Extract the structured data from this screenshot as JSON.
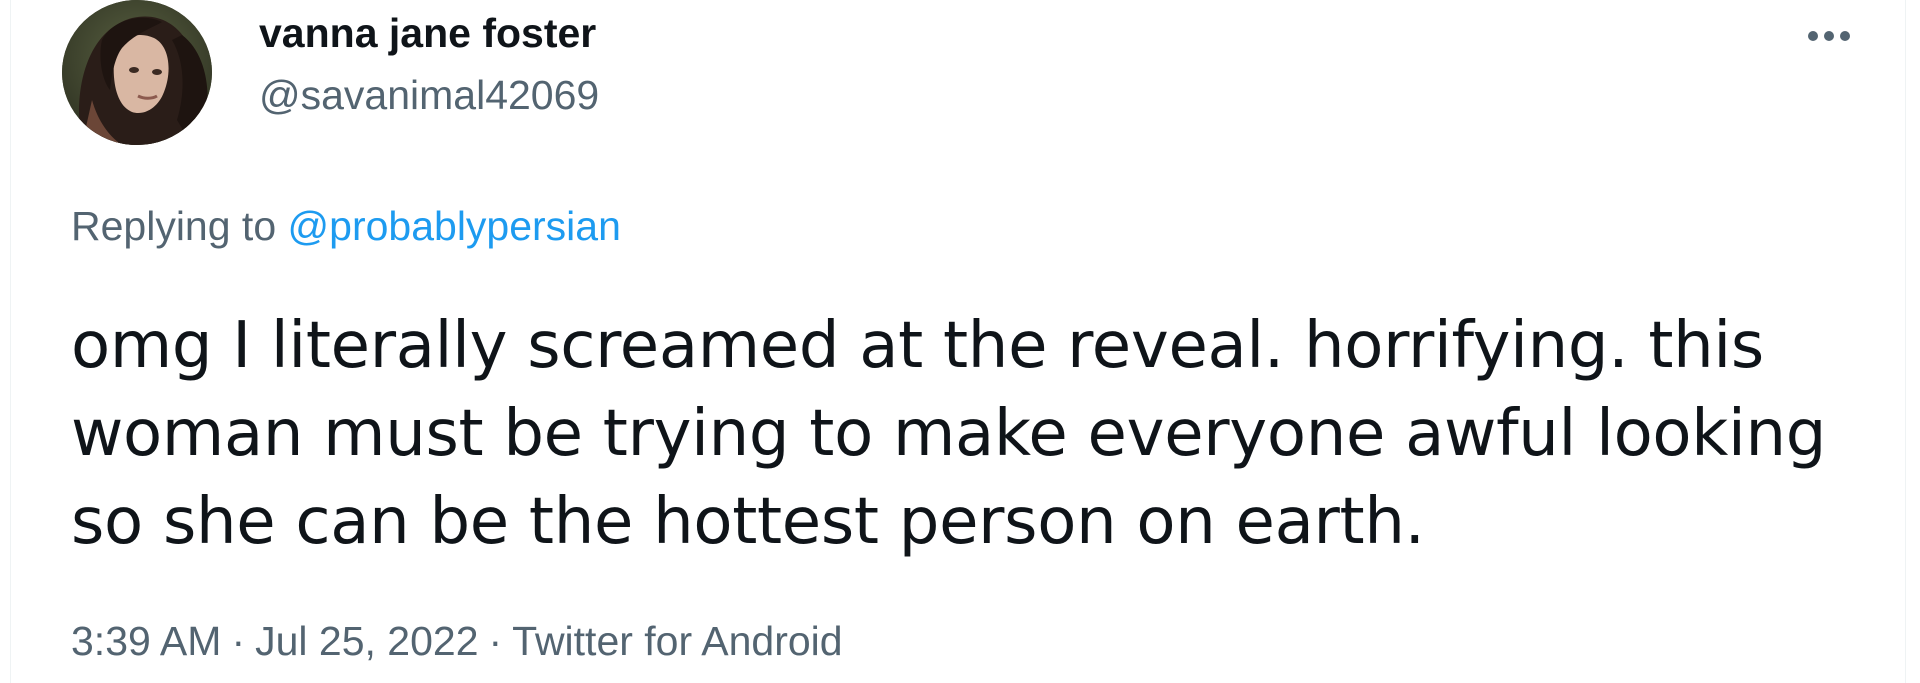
{
  "author": {
    "display_name": "vanna jane foster",
    "handle": "@savanimal42069",
    "avatar_icon": "profile-photo"
  },
  "more_icon": "more-horizontal-icon",
  "reply": {
    "prefix": "Replying to",
    "mention": "@probablypersian"
  },
  "tweet": {
    "lines": [
      "omg I literally screamed at the reveal. horrifying. this",
      "woman must be trying to make everyone awful looking",
      "so she can be the hottest person on earth."
    ]
  },
  "meta": {
    "time": "3:39 AM",
    "separator": "·",
    "date": "Jul 25, 2022",
    "source": "Twitter for Android"
  },
  "colors": {
    "text_primary": "#0f1419",
    "text_secondary": "#536471",
    "accent_link": "#1d9bf0",
    "border": "#eff3f4"
  }
}
